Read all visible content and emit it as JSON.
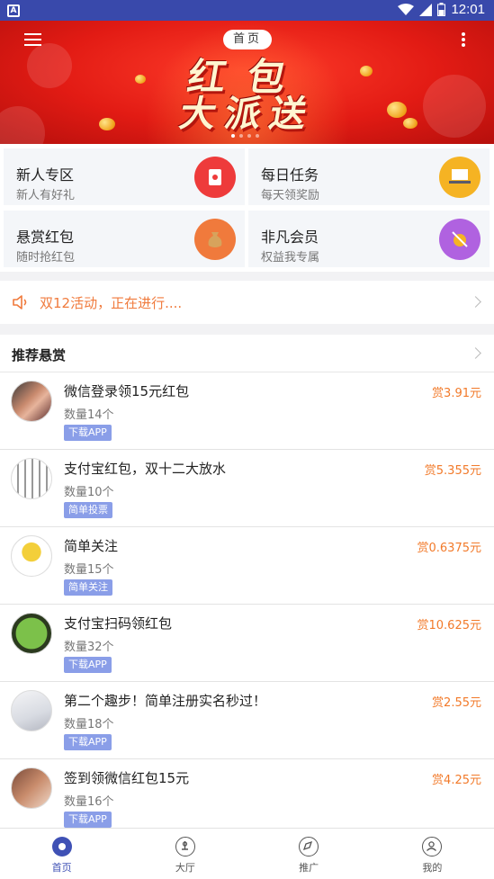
{
  "status_bar": {
    "time": "12:01",
    "sim_label": "A"
  },
  "header": {
    "title": "首页"
  },
  "banner": {
    "line1": "红包",
    "line2": "大派送"
  },
  "tiles": [
    {
      "title": "新人专区",
      "subtitle": "新人有好礼",
      "icon": "red-envelope-icon",
      "color": "#ee3b3b"
    },
    {
      "title": "每日任务",
      "subtitle": "每天领奖励",
      "icon": "laptop-icon",
      "color": "#f5b323"
    },
    {
      "title": "悬赏红包",
      "subtitle": "随时抢红包",
      "icon": "money-bag-icon",
      "color": "#f07a3c"
    },
    {
      "title": "非凡会员",
      "subtitle": "权益我专属",
      "icon": "vip-coin-icon",
      "color": "#b062e0"
    }
  ],
  "notice": {
    "text": "双12活动，正在进行....",
    "icon": "speaker-icon"
  },
  "recommend": {
    "title": "推荐悬赏"
  },
  "items": [
    {
      "title": "微信登录领15元红包",
      "count": "数量14个",
      "tag": "下载APP",
      "reward": "赏3.91元"
    },
    {
      "title": "支付宝红包，双十二大放水",
      "count": "数量10个",
      "tag": "简单投票",
      "reward": "赏5.355元"
    },
    {
      "title": "简单关注",
      "count": "数量15个",
      "tag": "简单关注",
      "reward": "赏0.6375元"
    },
    {
      "title": "支付宝扫码领红包",
      "count": "数量32个",
      "tag": "下载APP",
      "reward": "赏10.625元"
    },
    {
      "title": "第二个趣步！简单注册实名秒过！",
      "count": "数量18个",
      "tag": "下载APP",
      "reward": "赏2.55元"
    },
    {
      "title": "签到领微信红包15元",
      "count": "数量16个",
      "tag": "下载APP",
      "reward": "赏4.25元"
    }
  ],
  "tabbar": [
    {
      "label": "首页",
      "active": true
    },
    {
      "label": "大厅",
      "active": false
    },
    {
      "label": "推广",
      "active": false
    },
    {
      "label": "我的",
      "active": false
    }
  ],
  "colors": {
    "primary": "#3f51b5",
    "accent_orange": "#f27a2a",
    "banner_red": "#e21b14"
  }
}
